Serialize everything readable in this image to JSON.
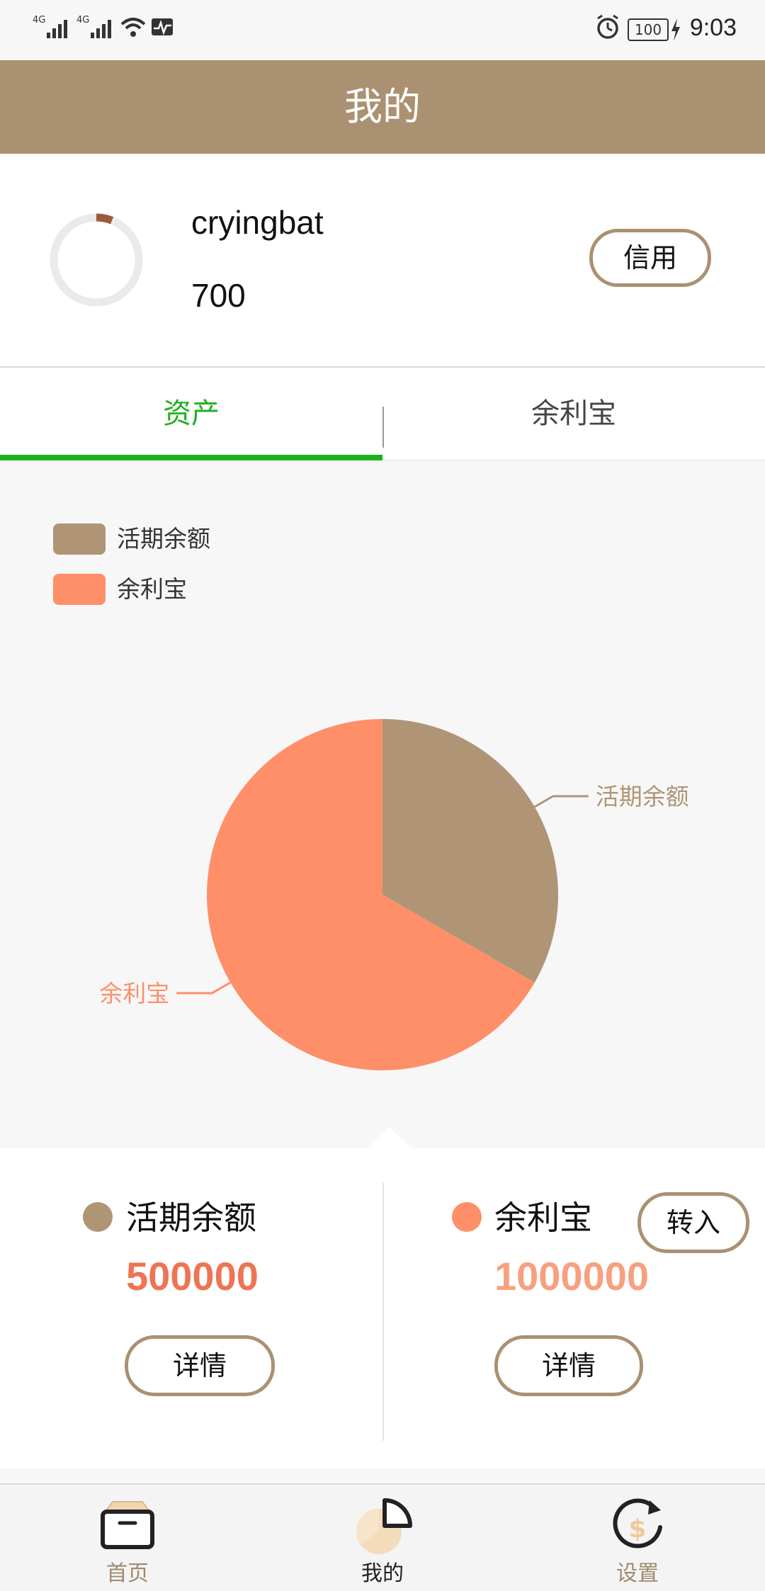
{
  "status_bar": {
    "net1": "4G",
    "net2": "4G",
    "battery": "100",
    "time": "9:03"
  },
  "header": {
    "title": "我的"
  },
  "profile": {
    "username": "cryingbat",
    "score": "700",
    "credit_button": "信用",
    "ring_progress": 0.06
  },
  "tabs": [
    {
      "label": "资产",
      "active": true
    },
    {
      "label": "余利宝",
      "active": false
    }
  ],
  "chart_data": {
    "type": "pie",
    "series": [
      {
        "name": "活期余额",
        "value": 500000,
        "color": "#af9576"
      },
      {
        "name": "余利宝",
        "value": 1000000,
        "color": "#ff8f68"
      }
    ],
    "legend_placement": "top-left"
  },
  "cards": {
    "left": {
      "title": "活期余额",
      "value": "500000",
      "detail": "详情",
      "dot_color": "#af9576",
      "value_color": "#ee7454"
    },
    "right": {
      "title": "余利宝",
      "value": "1000000",
      "detail": "详情",
      "transfer": "转入",
      "dot_color": "#ff8f68",
      "value_color": "#f7a07f"
    }
  },
  "bottom_nav": [
    {
      "label": "首页",
      "icon": "box-icon",
      "active": false
    },
    {
      "label": "我的",
      "icon": "pie-chart-icon",
      "active": true
    },
    {
      "label": "设置",
      "icon": "refresh-dollar-icon",
      "active": false
    }
  ],
  "colors": {
    "brand": "#aa9172",
    "tab_active": "#1db21d",
    "nav_inactive": "#a08a6c",
    "nav_active": "#222222"
  }
}
